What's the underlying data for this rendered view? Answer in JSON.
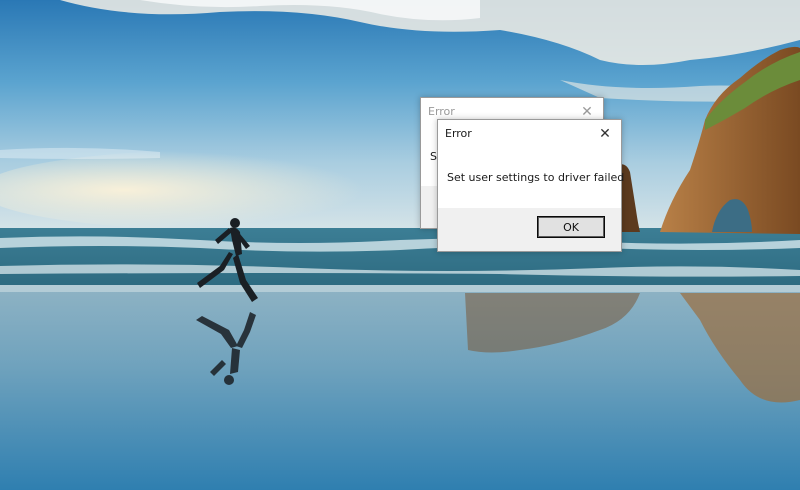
{
  "desktop": {
    "wallpaper": "beach-runner-wallpaper"
  },
  "dialogs": {
    "back": {
      "title": "Error",
      "message_partial": "Se",
      "close_icon": "close-icon"
    },
    "front": {
      "title": "Error",
      "message": "Set user settings to driver failed",
      "ok_label": "OK",
      "close_icon": "close-icon"
    }
  },
  "colors": {
    "dialog_bg": "#ffffff",
    "dialog_footer": "#f0f0f0",
    "button_bg": "#e1e1e1",
    "sky_top": "#2f7fb8",
    "sea": "#3f7f97"
  }
}
